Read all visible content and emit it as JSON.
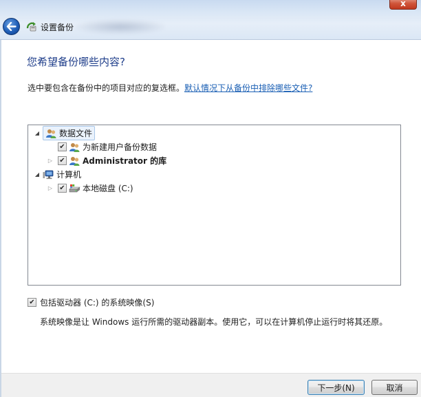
{
  "window": {
    "title": "设置备份",
    "close_label": "x"
  },
  "page": {
    "heading": "您希望备份哪些内容?",
    "instruction": "选中要包含在备份中的项目对应的复选框。",
    "exclude_link": "默认情况下从备份中排除哪些文件?"
  },
  "tree": {
    "items": [
      {
        "label": "数据文件",
        "checked": null,
        "expanded": true,
        "bold": false,
        "icon": "users-icon"
      },
      {
        "label": "为新建用户备份数据",
        "checked": true,
        "expanded": null,
        "bold": false,
        "icon": "users-icon"
      },
      {
        "label": "Administrator 的库",
        "checked": true,
        "expanded": false,
        "bold": true,
        "icon": "users-icon"
      },
      {
        "label": "计算机",
        "checked": null,
        "expanded": true,
        "bold": false,
        "icon": "computer-icon"
      },
      {
        "label": "本地磁盘 (C:)",
        "checked": true,
        "expanded": false,
        "bold": false,
        "icon": "drive-icon"
      }
    ]
  },
  "system_image": {
    "checkbox_label": "包括驱动器 (C:) 的系统映像(S)",
    "checked": true,
    "note": "系统映像是让 Windows 运行所需的驱动器副本。使用它，可以在计算机停止运行时将其还原。"
  },
  "footer": {
    "next_label": "下一步(N)",
    "cancel_label": "取消"
  },
  "colors": {
    "heading": "#1e3d8a",
    "link": "#1a5fb4"
  }
}
